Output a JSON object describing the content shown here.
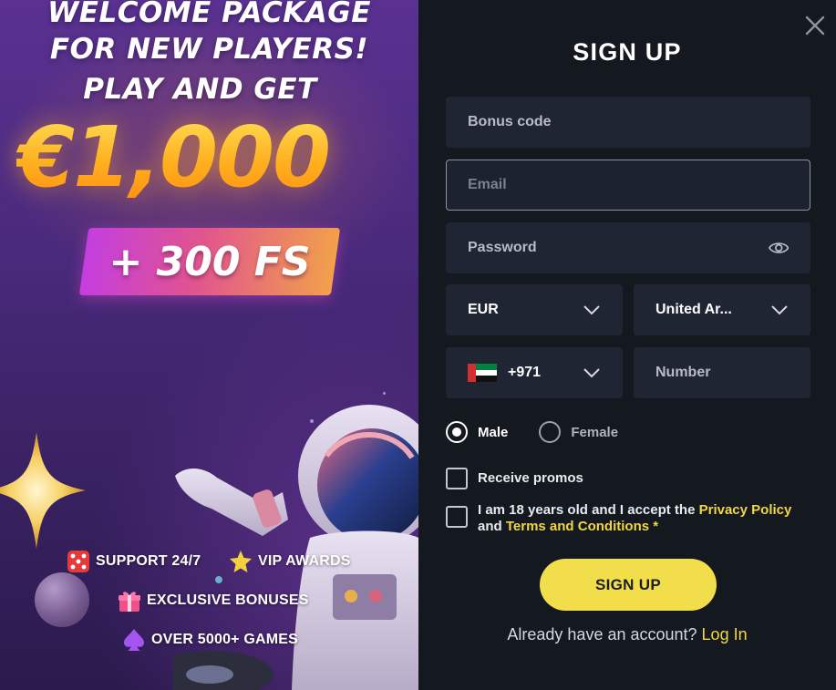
{
  "promo": {
    "headline_line1": "WELCOME PACKAGE",
    "headline_line2": "FOR NEW PLAYERS!",
    "headline_line3": "PLAY AND GET",
    "amount": "€1,000",
    "free_spins": "+ 300 FS",
    "features": [
      {
        "label": "SUPPORT 24/7",
        "icon": "dice-icon"
      },
      {
        "label": "VIP AWARDS",
        "icon": "star-icon"
      },
      {
        "label": "EXCLUSIVE BONUSES",
        "icon": "gift-icon"
      },
      {
        "label": "OVER 5000+ GAMES",
        "icon": "spade-icon"
      }
    ]
  },
  "form": {
    "title": "SIGN UP",
    "bonus_code_placeholder": "Bonus code",
    "email_placeholder": "Email",
    "password_placeholder": "Password",
    "currency": "EUR",
    "country": "United Ar...",
    "phone_code": "+971",
    "phone_placeholder": "Number",
    "gender": {
      "male": "Male",
      "female": "Female",
      "selected": "male"
    },
    "receive_promos": "Receive promos",
    "terms_prefix": "I am 18 years old and I accept the ",
    "privacy_policy": "Privacy Policy",
    "terms_and": "and ",
    "terms_and_conditions": "Terms and Conditions",
    "required_marker": " *",
    "signup_button": "SIGN UP",
    "already_text": "Already have an account? ",
    "login_link": "Log In"
  },
  "colors": {
    "accent": "#f2dd4b",
    "panel_bg": "#14181f",
    "field_bg": "#1f2533"
  }
}
